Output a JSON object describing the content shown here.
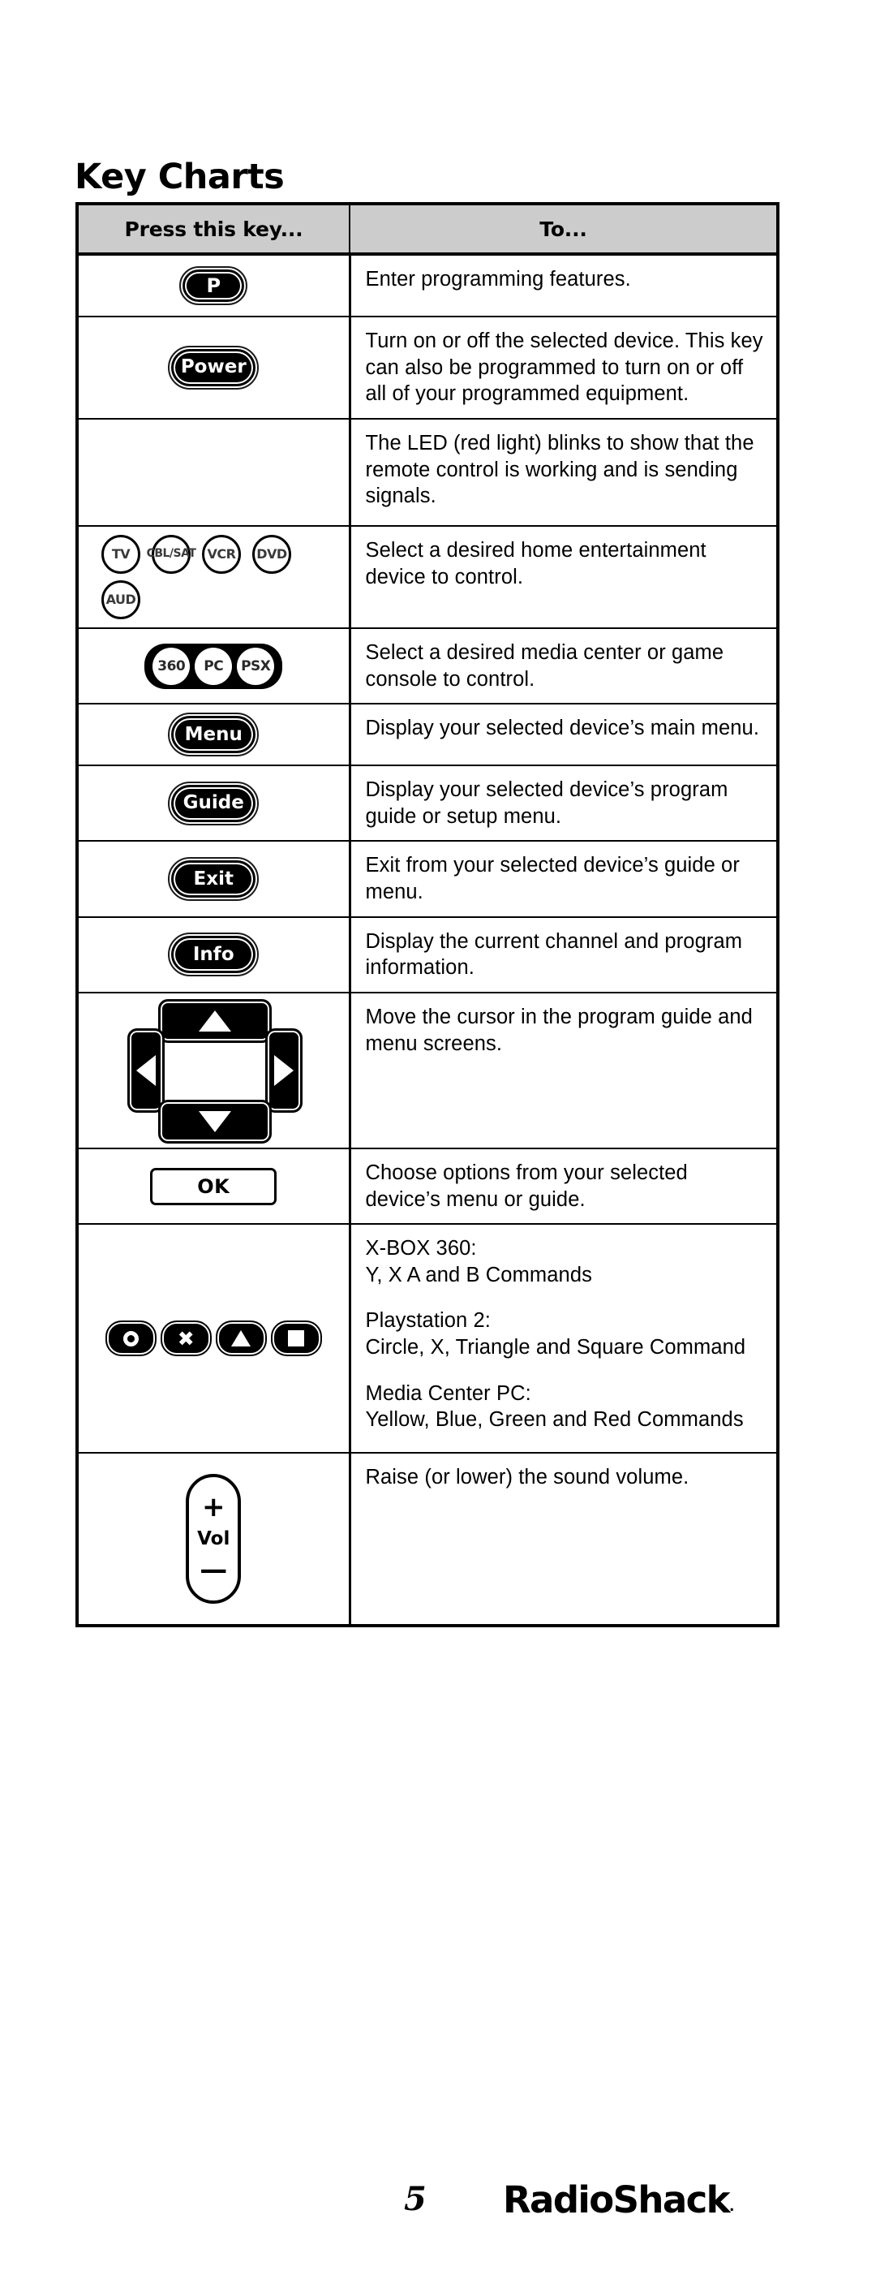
{
  "document": {
    "title": "Key Charts",
    "page_number": "5",
    "brand": "RadioShack",
    "brand_mark": "."
  },
  "table": {
    "headers": {
      "key_column": "Press this key...",
      "to_column": "To..."
    },
    "rows": [
      {
        "key_icon": "p-button",
        "key_label": "P",
        "descriptions": [
          "Enter programming features."
        ]
      },
      {
        "key_icon": "power-button",
        "key_label": "Power",
        "descriptions": [
          "Turn on or off the selected device. This key can also be programmed to turn on or off all of your programmed equipment."
        ]
      },
      {
        "key_icon": "none",
        "key_label": "",
        "descriptions": [
          "The LED (red light) blinks to show that the remote control is working and is sending signals."
        ]
      },
      {
        "key_icon": "device-buttons",
        "device_keys": [
          "TV",
          "CBL/​SAT",
          "VCR",
          "DVD",
          "AUD"
        ],
        "device_keys_line1": [
          "TV",
          "CBL/SAT",
          "VCR",
          "DVD"
        ],
        "device_keys_line2": [
          "AUD"
        ],
        "descriptions": [
          "Select a desired home entertainment device to control."
        ]
      },
      {
        "key_icon": "console-buttons",
        "console_keys": [
          "360",
          "PC",
          "PSX"
        ],
        "descriptions": [
          "Select a desired media center or game console to control."
        ]
      },
      {
        "key_icon": "menu-button",
        "key_label": "Menu",
        "descriptions": [
          "Display your selected device’s main menu."
        ]
      },
      {
        "key_icon": "guide-button",
        "key_label": "Guide",
        "descriptions": [
          "Display your selected device’s program guide or setup menu."
        ]
      },
      {
        "key_icon": "exit-button",
        "key_label": "Exit",
        "descriptions": [
          "Exit from your selected device’s guide or menu."
        ]
      },
      {
        "key_icon": "info-button",
        "key_label": "Info",
        "descriptions": [
          "Display the current channel and program information."
        ]
      },
      {
        "key_icon": "arrow-pad",
        "arrow_labels": [
          "up",
          "down",
          "left",
          "right"
        ],
        "descriptions": [
          "Move the cursor in the program guide and menu screens."
        ]
      },
      {
        "key_icon": "ok-button",
        "key_label": "OK",
        "descriptions": [
          "Choose options from your selected device’s menu or guide."
        ]
      },
      {
        "key_icon": "game-symbol-buttons",
        "game_symbols": [
          "circle",
          "x",
          "triangle",
          "square"
        ],
        "descriptions": [
          "X-BOX 360:\nY, X A and B Commands",
          "Playstation 2:\nCircle, X, Triangle and Square Command",
          "Media Center PC:\nYellow, Blue, Green and Red Commands"
        ],
        "desc_blocks": [
          {
            "heading": "X-BOX 360:",
            "body": "Y, X A and B Commands"
          },
          {
            "heading": "Playstation 2:",
            "body": "Circle, X, Triangle and Square Command"
          },
          {
            "heading": "Media Center PC:",
            "body": "Yellow, Blue, Green and Red Commands"
          }
        ]
      },
      {
        "key_icon": "volume-rocker",
        "volume": {
          "plus": "+",
          "label": "Vol",
          "minus": "—"
        },
        "descriptions": [
          "Raise (or lower) the sound volume."
        ]
      }
    ]
  }
}
